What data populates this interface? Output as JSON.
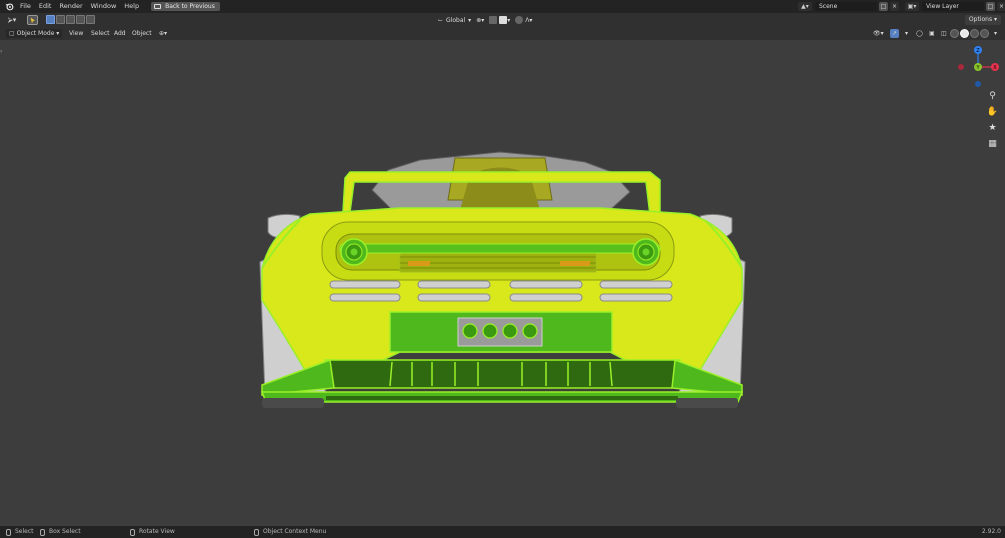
{
  "topbar": {
    "menu": [
      "File",
      "Edit",
      "Render",
      "Window",
      "Help"
    ],
    "back_button": "Back to Previous",
    "scene": "Scene",
    "view_layer": "View Layer"
  },
  "header": {
    "orientation": "Global",
    "options": "Options"
  },
  "viewport_header": {
    "mode": "Object Mode",
    "menus": [
      "View",
      "Select",
      "Add",
      "Object"
    ]
  },
  "gizmo": {
    "axes": [
      "Z",
      "Y",
      "X"
    ],
    "colors": {
      "x": "#e6334d",
      "y": "#89c32b",
      "z": "#2e82f5"
    }
  },
  "statusbar": {
    "items": [
      "Select",
      "Box Select",
      "Rotate View",
      "Object Context Menu"
    ],
    "version": "2.92.0"
  },
  "colors": {
    "selected_yellow": "#d8e81a",
    "selected_green": "#4fb81c",
    "outline": "#9af028",
    "body_white": "#c8c8c8",
    "background": "#3d3d3d"
  }
}
